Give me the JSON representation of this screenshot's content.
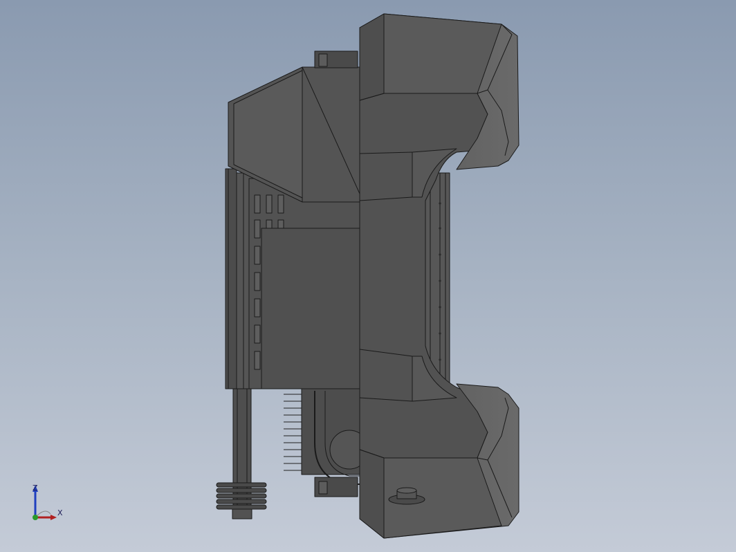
{
  "view": {
    "background_top": "#8a9ab0",
    "background_bottom": "#c4cbd7",
    "model_fill": "#505050",
    "model_edge": "#1a1a1a"
  },
  "triad": {
    "z_label": "Z",
    "x_label": "X",
    "z_color": "#1f3fbf",
    "x_color": "#b02020",
    "y_color": "#2a9a2a"
  }
}
